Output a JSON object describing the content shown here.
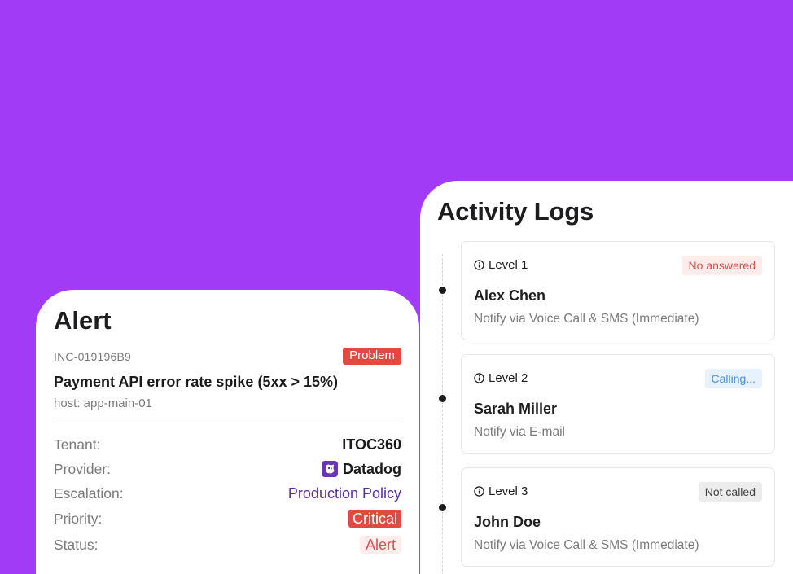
{
  "activity": {
    "title": "Activity Logs",
    "levels": [
      {
        "level": "Level 1",
        "status": "No answered",
        "name": "Alex Chen",
        "notify": "Notify via Voice Call & SMS (Immediate)"
      },
      {
        "level": "Level 2",
        "status": "Calling...",
        "name": "Sarah Miller",
        "notify": "Notify via E-mail"
      },
      {
        "level": "Level 3",
        "status": "Not called",
        "name": "John Doe",
        "notify": "Notify via Voice Call & SMS (Immediate)"
      }
    ]
  },
  "alert": {
    "title": "Alert",
    "incident_id": "INC-019196B9",
    "badge": "Problem",
    "headline": "Payment API error rate spike (5xx > 15%)",
    "host": "host: app-main-01",
    "details": [
      {
        "label": "Tenant:",
        "value": "ITOC360"
      },
      {
        "label": "Provider:",
        "value": "Datadog",
        "icon": "datadog-icon"
      },
      {
        "label": "Escalation:",
        "value": "Production Policy"
      },
      {
        "label": "Priority:",
        "value": "Critical"
      },
      {
        "label": "Status:",
        "value": "Alert"
      }
    ]
  },
  "colors": {
    "background": "#a23bf6",
    "problem_red": "#e04a41",
    "link_purple": "#5b2fa8",
    "calling_blue": "#4a8fd6"
  }
}
